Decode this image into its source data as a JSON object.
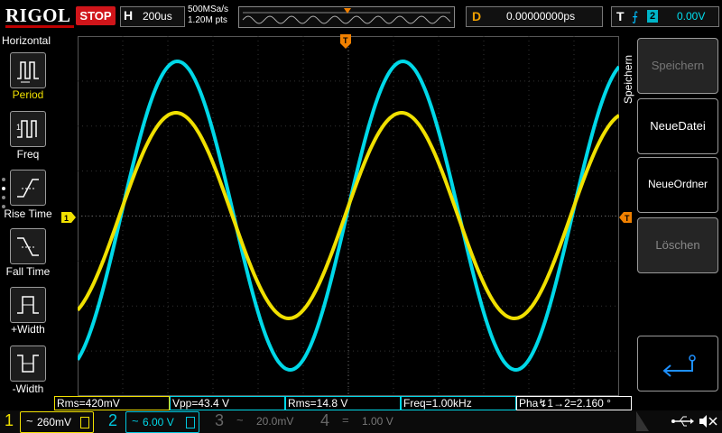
{
  "header": {
    "logo": "RIGOL",
    "run_state": "STOP",
    "timebase_label": "H",
    "timebase_value": "200us",
    "sample_rate": "500MSa/s",
    "memory_depth": "1.20M pts",
    "delay_label": "D",
    "delay_value": "0.00000000ps",
    "trigger_label": "T",
    "trigger_source": "2",
    "trigger_level": "0.00V"
  },
  "left_panel": {
    "title": "Horizontal",
    "items": [
      {
        "label": "Period"
      },
      {
        "label": "Freq"
      },
      {
        "label": "Rise Time"
      },
      {
        "label": "Fall Time"
      },
      {
        "label": "+Width"
      },
      {
        "label": "-Width"
      }
    ]
  },
  "right_menu": {
    "title": "Speichern",
    "items": [
      {
        "label": "Speichern",
        "enabled": false
      },
      {
        "label": "NeueDatei",
        "enabled": true
      },
      {
        "label": "NeueOrdner",
        "enabled": true
      },
      {
        "label": "Löschen",
        "enabled": false
      }
    ]
  },
  "markers": {
    "ch1_level": "1",
    "trigger_pos": "T",
    "trigger_level": "T"
  },
  "measurements": [
    {
      "text": "Rms=420mV",
      "color": "#f0e000"
    },
    {
      "text": "Vpp=43.4 V",
      "color": "#00d8e8"
    },
    {
      "text": "Rms=14.8 V",
      "color": "#00d8e8"
    },
    {
      "text": "Freq=1.00kHz",
      "color": "#00d8e8"
    },
    {
      "text": "Pha↯1→2=2.160 °",
      "color": "#ffffff"
    }
  ],
  "channels": [
    {
      "number": "1",
      "coupling": "~",
      "scale": "260mV",
      "color": "#f0e000",
      "active": true
    },
    {
      "number": "2",
      "coupling": "~",
      "scale": "6.00 V",
      "color": "#00c8e0",
      "active": true
    },
    {
      "number": "3",
      "coupling": "~",
      "scale": "20.0mV",
      "color": "#666666",
      "active": false
    },
    {
      "number": "4",
      "coupling": "=",
      "scale": "1.00 V",
      "color": "#666666",
      "active": false
    }
  ],
  "colors": {
    "ch1": "#f0e000",
    "ch2": "#00d8e8",
    "trigger": "#f08000",
    "grid": "#3a3a3a"
  }
}
